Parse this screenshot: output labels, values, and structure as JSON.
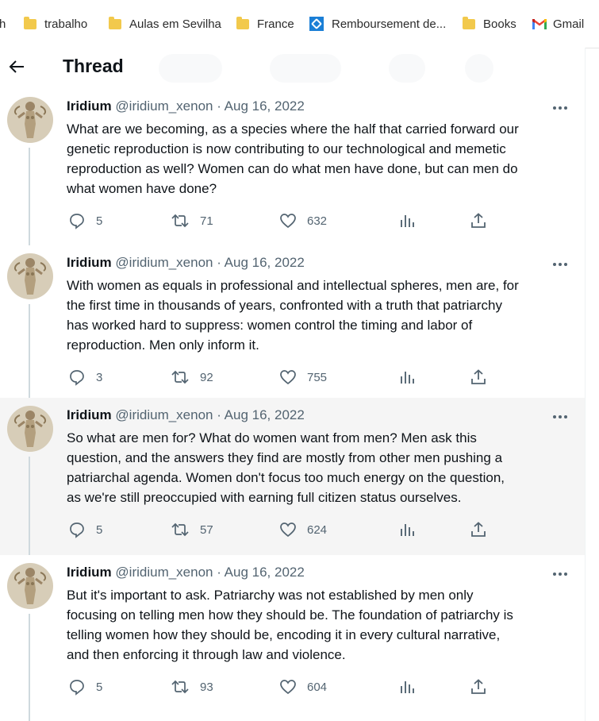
{
  "bookmarks": [
    {
      "label": "h",
      "icon": "none"
    },
    {
      "label": "trabalho",
      "icon": "folder-icon"
    },
    {
      "label": "Aulas em Sevilha",
      "icon": "folder-icon"
    },
    {
      "label": "France",
      "icon": "folder-icon"
    },
    {
      "label": "Remboursement de...",
      "icon": "app-icon"
    },
    {
      "label": "Books",
      "icon": "folder-icon"
    },
    {
      "label": "Gmail",
      "icon": "gmail-icon"
    }
  ],
  "header": {
    "title": "Thread",
    "back_icon": "arrow-left-icon"
  },
  "colors": {
    "text": "#0f1419",
    "secondary": "#536471",
    "folder": "#f2c94c",
    "highlight_bg": "#f5f5f5",
    "thread_line": "#cfd9de"
  },
  "tweets": [
    {
      "name": "Iridium",
      "handle": "@iridium_xenon",
      "date": "· Aug 16, 2022",
      "lines": [
        "What are we becoming, as a species where the half that carried forward our",
        "genetic reproduction is now contributing to our technological and memetic",
        "reproduction as well? Women can do what men have done, but can men do",
        "what women have done?"
      ],
      "replies": "5",
      "retweets": "71",
      "likes": "632",
      "highlighted": false
    },
    {
      "name": "Iridium",
      "handle": "@iridium_xenon",
      "date": "· Aug 16, 2022",
      "lines": [
        "With women as equals in professional and intellectual spheres, men are, for",
        "the first time in thousands of years, confronted with a truth that patriarchy",
        "has worked hard to suppress: women control the timing and labor of",
        "reproduction. Men only inform it."
      ],
      "replies": "3",
      "retweets": "92",
      "likes": "755",
      "highlighted": false
    },
    {
      "name": "Iridium",
      "handle": "@iridium_xenon",
      "date": "· Aug 16, 2022",
      "lines": [
        "So what are men for? What do women want from men? Men ask this",
        "question, and the answers they find are mostly from other men pushing a",
        "patriarchal agenda. Women don't focus too much energy on the question,",
        "as we're still preoccupied with earning full citizen status ourselves."
      ],
      "replies": "5",
      "retweets": "57",
      "likes": "624",
      "highlighted": true
    },
    {
      "name": "Iridium",
      "handle": "@iridium_xenon",
      "date": "· Aug 16, 2022",
      "lines": [
        "But it's important to ask. Patriarchy was not established by men only",
        "focusing on telling men how they should be. The foundation of patriarchy is",
        "telling women how they should be, encoding it in every cultural narrative,",
        "and then enforcing it through law and violence."
      ],
      "replies": "5",
      "retweets": "93",
      "likes": "604",
      "highlighted": false
    }
  ],
  "action_icons": [
    "reply-icon",
    "retweet-icon",
    "like-icon",
    "analytics-icon",
    "share-icon"
  ]
}
